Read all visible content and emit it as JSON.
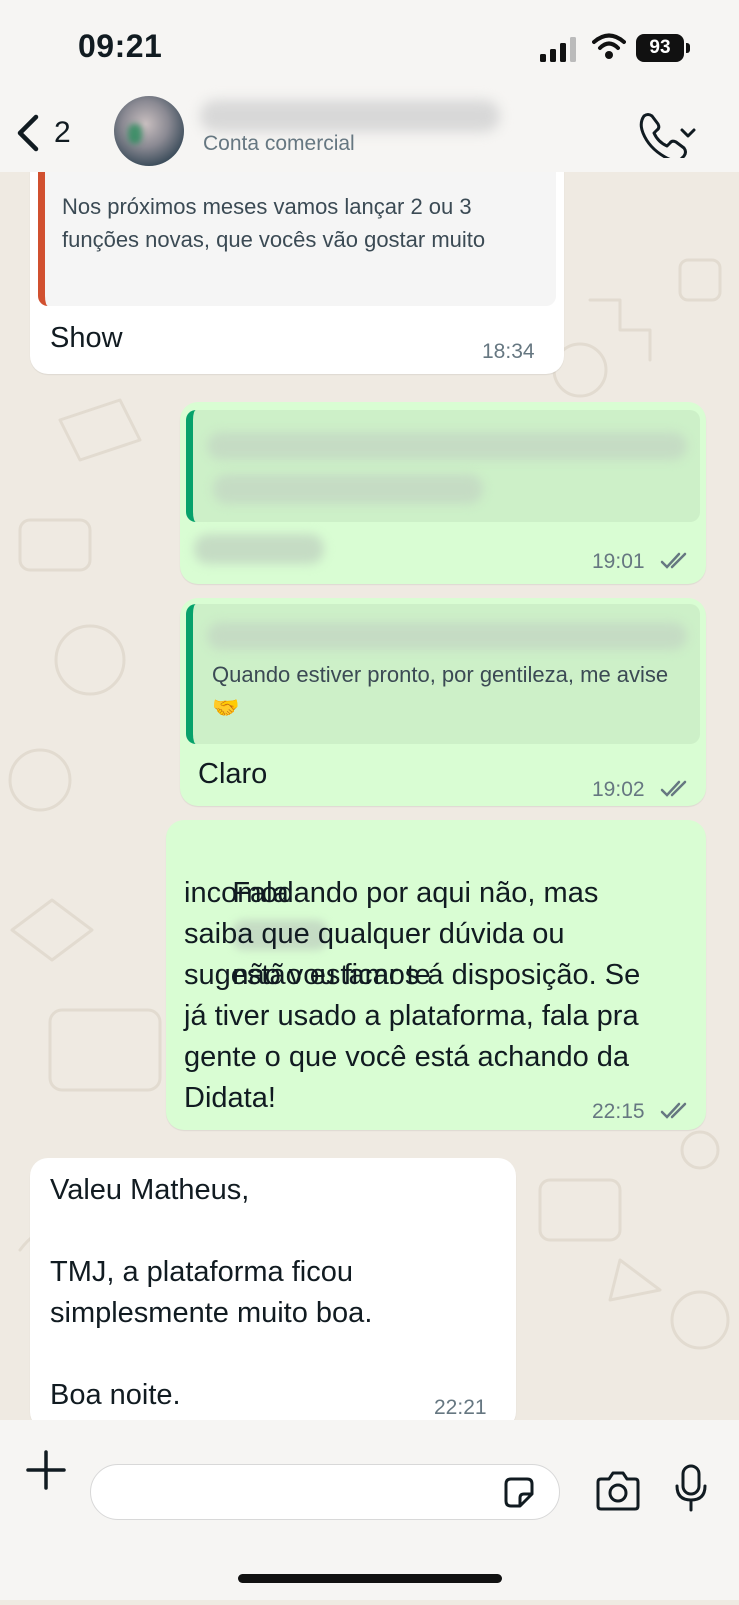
{
  "status_bar": {
    "time": "09:21",
    "battery": "93"
  },
  "header": {
    "unread_count": "2",
    "contact_subtitle": "Conta comercial"
  },
  "messages": [
    {
      "direction": "incoming",
      "quoted_text": "Nos próximos meses vamos lançar 2 ou 3 funções novas, que vocês vão gostar muito",
      "text": "Show",
      "time": "18:34"
    },
    {
      "direction": "outgoing",
      "time": "19:01",
      "read": true
    },
    {
      "direction": "outgoing",
      "quoted_text": "Quando estiver pronto, por gentileza, me avise 🤝",
      "text": "Claro",
      "time": "19:02",
      "read": true
    },
    {
      "direction": "outgoing",
      "text_start": "Fala",
      "text_rest": "não vou ficar te",
      "text_lines": [
        "incomodando por aqui não, mas",
        "saiba que qualquer dúvida ou",
        "sugestão estamos á disposição. Se",
        "já tiver usado a plataforma, fala pra",
        "gente o que você está achando da",
        "Didata!"
      ],
      "time": "22:15",
      "read": true
    },
    {
      "direction": "incoming",
      "text": "Valeu Matheus,\n\nTMJ, a plataforma ficou\nsimplesmente muito boa.\n\nBoa noite.",
      "time": "22:21"
    }
  ],
  "input": {
    "placeholder": ""
  },
  "colors": {
    "outgoing_bubble": "#d9fdd3",
    "incoming_bubble": "#ffffff",
    "quote_accent_in": "#d1502f",
    "quote_accent_out": "#06a26b",
    "background": "#efeae2"
  }
}
